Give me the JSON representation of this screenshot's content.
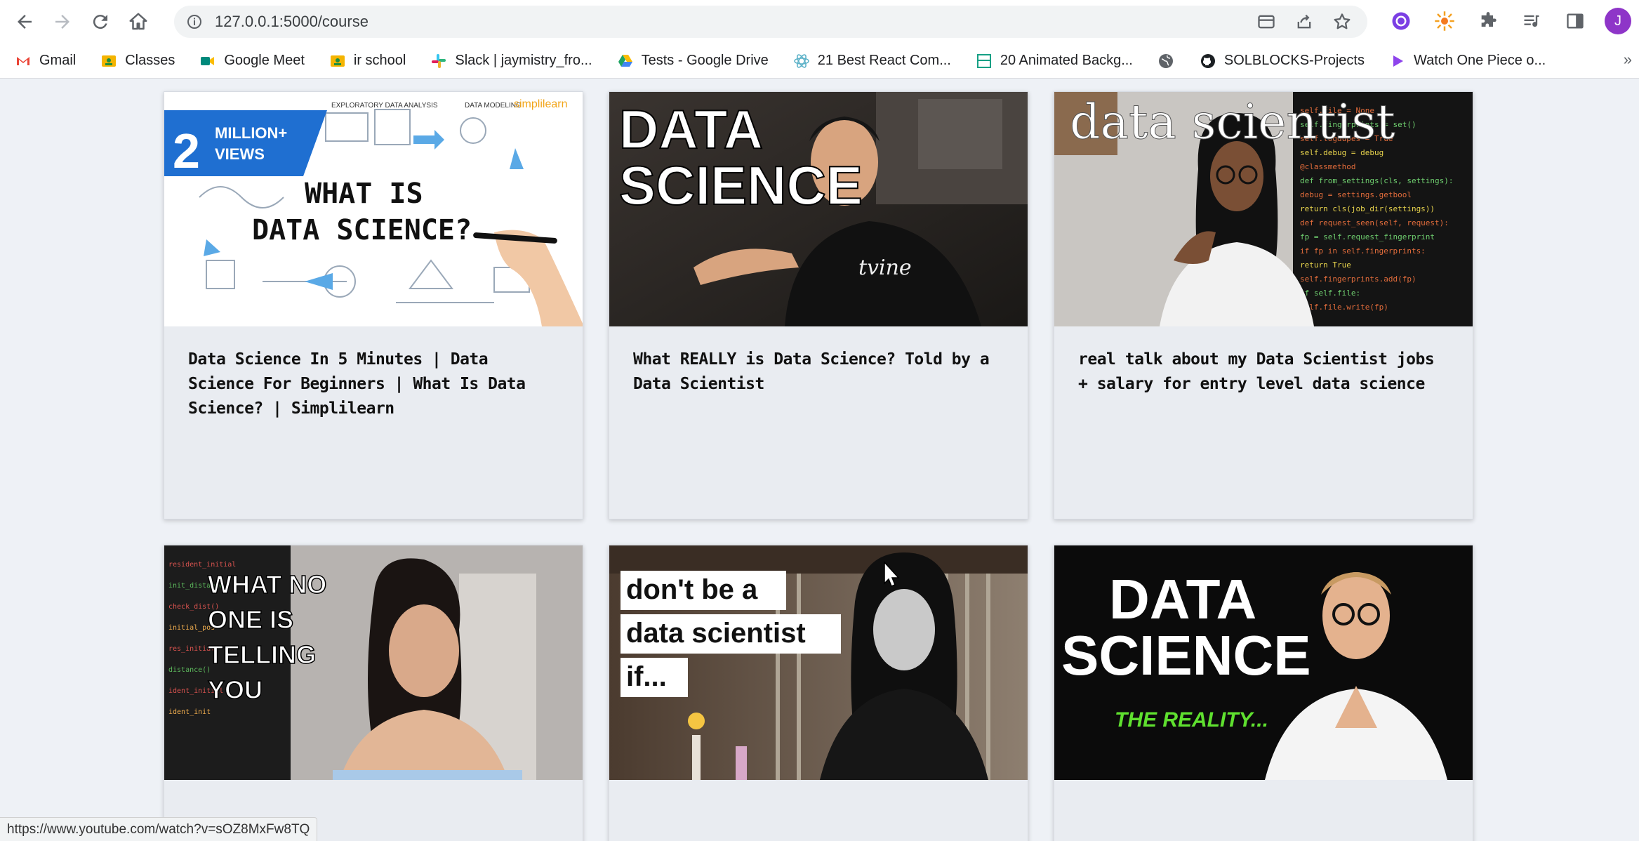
{
  "browser": {
    "url": "127.0.0.1:5000/course",
    "avatar_letter": "J",
    "bookmarks": [
      {
        "label": "Gmail",
        "icon": "gmail-icon"
      },
      {
        "label": "Classes",
        "icon": "classroom-icon"
      },
      {
        "label": "Google Meet",
        "icon": "meet-icon"
      },
      {
        "label": "ir school",
        "icon": "classroom-icon"
      },
      {
        "label": "Slack | jaymistry_fro...",
        "icon": "slack-icon"
      },
      {
        "label": "Tests - Google Drive",
        "icon": "drive-icon"
      },
      {
        "label": "21 Best React Com...",
        "icon": "react-icon"
      },
      {
        "label": "20 Animated Backg...",
        "icon": "layout-icon"
      },
      {
        "label": "",
        "icon": "globe-icon"
      },
      {
        "label": "SOLBLOCKS-Projects",
        "icon": "github-icon"
      },
      {
        "label": "Watch One Piece o...",
        "icon": "play-icon"
      }
    ],
    "bookmarks_more": "»",
    "status_url": "https://www.youtube.com/watch?v=sOZ8MxFw8TQ"
  },
  "courses": [
    {
      "title": "Data Science In 5 Minutes | Data Science For Beginners | What Is Data Science? | Simplilearn",
      "thumb": {
        "badge_big": "2",
        "badge_small": "MILLION+ VIEWS",
        "headline": "WHAT IS DATA SCIENCE?",
        "brand": "simplilearn",
        "labels": [
          "EXPLORATORY DATA ANALYSIS",
          "DATA MODELING"
        ]
      }
    },
    {
      "title": "What REALLY is Data Science? Told by a Data Scientist",
      "thumb": {
        "headline_1": "DATA",
        "headline_2": "SCIENCE",
        "shirt": "tvine"
      }
    },
    {
      "title": "real talk about my Data Scientist jobs + salary for entry level data science",
      "thumb": {
        "headline": "data scientist"
      }
    },
    {
      "title": "",
      "thumb": {
        "lines": [
          "WHAT NO",
          "ONE IS",
          "TELLING",
          "YOU"
        ]
      }
    },
    {
      "title": "",
      "thumb": {
        "lines": [
          "don't be a",
          "data scientist",
          "if..."
        ]
      }
    },
    {
      "title": "",
      "thumb": {
        "headline_1": "DATA",
        "headline_2": "SCIENCE",
        "sub": "THE REALITY..."
      }
    }
  ]
}
